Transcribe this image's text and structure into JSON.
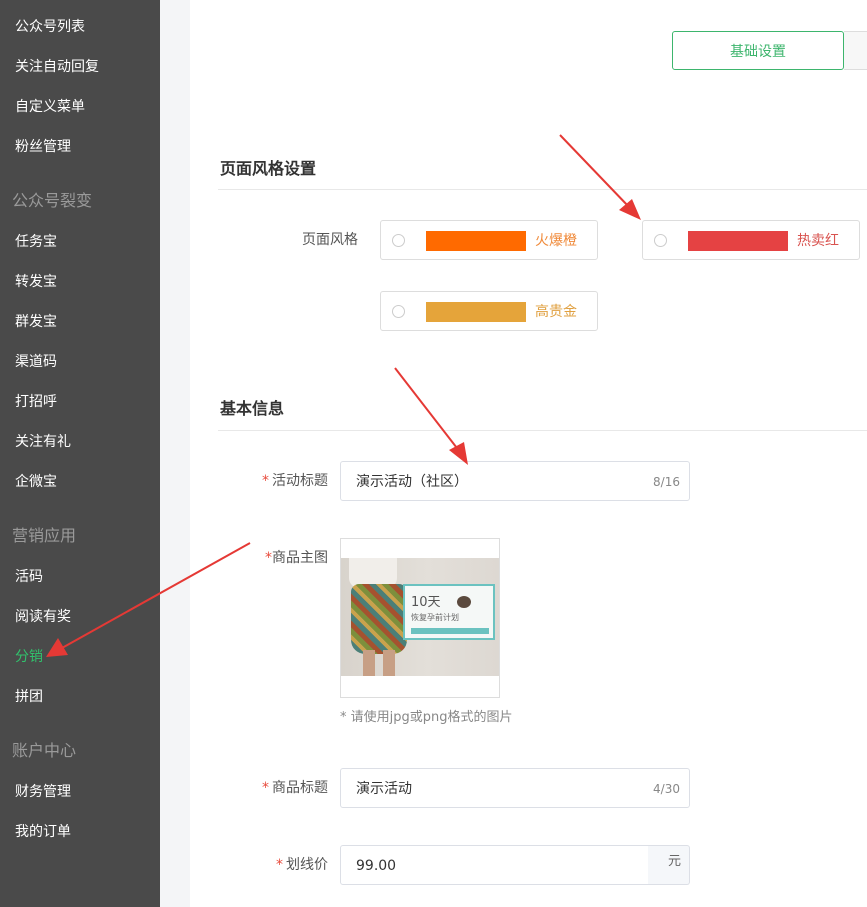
{
  "sidebar": {
    "top_items": [
      {
        "label": "公众号列表"
      },
      {
        "label": "关注自动回复"
      },
      {
        "label": "自定义菜单"
      },
      {
        "label": "粉丝管理"
      }
    ],
    "groups": [
      {
        "title": "公众号裂变",
        "items": [
          {
            "label": "任务宝"
          },
          {
            "label": "转发宝"
          },
          {
            "label": "群发宝"
          },
          {
            "label": "渠道码"
          },
          {
            "label": "打招呼"
          },
          {
            "label": "关注有礼"
          },
          {
            "label": "企微宝"
          }
        ]
      },
      {
        "title": "营销应用",
        "items": [
          {
            "label": "活码"
          },
          {
            "label": "阅读有奖"
          },
          {
            "label": "分销"
          },
          {
            "label": "拼团"
          }
        ]
      },
      {
        "title": "账户中心",
        "items": [
          {
            "label": "财务管理"
          },
          {
            "label": "我的订单"
          }
        ]
      }
    ],
    "active_item": "分销",
    "colors": {
      "background": "#4a4a4a",
      "active": "#31c16c"
    }
  },
  "tabs": {
    "basic_settings": "基础设置"
  },
  "page_style": {
    "section_title": "页面风格设置",
    "label": "页面风格",
    "options": [
      {
        "name": "火爆橙",
        "color": "#ff6a00",
        "text_color": "#f08a3a"
      },
      {
        "name": "热卖红",
        "color": "#e54243",
        "text_color": "#d9534f"
      },
      {
        "name": "高贵金",
        "color": "#e5a43a",
        "text_color": "#e0a040"
      }
    ]
  },
  "basic_info": {
    "section_title": "基本信息",
    "activity_title": {
      "label": "活动标题",
      "value": "演示活动（社区）",
      "counter": "8/16"
    },
    "product_image": {
      "label": "商品主图",
      "image_text_main": "10天",
      "image_text_sub": "恢复孕前计划",
      "hint": "* 请使用jpg或png格式的图片"
    },
    "product_title": {
      "label": "商品标题",
      "value": "演示活动",
      "counter": "4/30"
    },
    "strike_price": {
      "label": "划线价",
      "value": "99.00",
      "unit": "元"
    }
  },
  "accent_color": "#3db56d",
  "annotation_color": "#e53935"
}
